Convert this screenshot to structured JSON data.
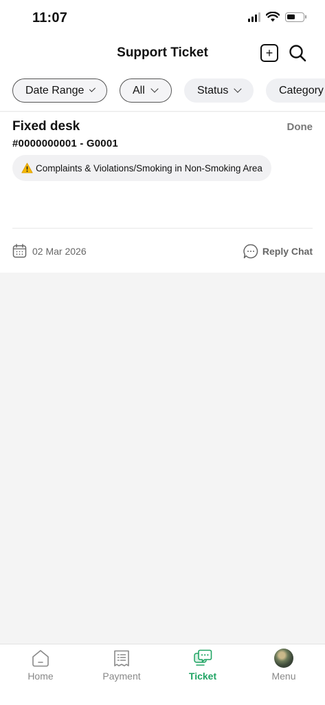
{
  "status_bar": {
    "time": "11:07"
  },
  "header": {
    "title": "Support Ticket",
    "add_icon": "plus-square-icon",
    "search_icon": "search-icon"
  },
  "filters": [
    {
      "label": "Date Range",
      "style": "outlined"
    },
    {
      "label": "All",
      "style": "outlined"
    },
    {
      "label": "Status",
      "style": "filled"
    },
    {
      "label": "Category",
      "style": "filled"
    }
  ],
  "tickets": [
    {
      "title": "Fixed desk",
      "status": "Done",
      "number": "#0000000001 - G0001",
      "category": "Complaints & Violations/Smoking in Non-Smoking Area",
      "date": "02 Mar 2026",
      "reply_label": "Reply Chat"
    }
  ],
  "bottom_nav": [
    {
      "label": "Home",
      "icon": "home-icon",
      "active": false
    },
    {
      "label": "Payment",
      "icon": "receipt-icon",
      "active": false
    },
    {
      "label": "Ticket",
      "icon": "ticket-chat-icon",
      "active": true
    },
    {
      "label": "Menu",
      "icon": "avatar",
      "active": false
    }
  ],
  "colors": {
    "accent": "#20a464",
    "muted_text": "#888888",
    "chip_bg": "#eff0f3",
    "content_bg": "#f4f4f4"
  }
}
